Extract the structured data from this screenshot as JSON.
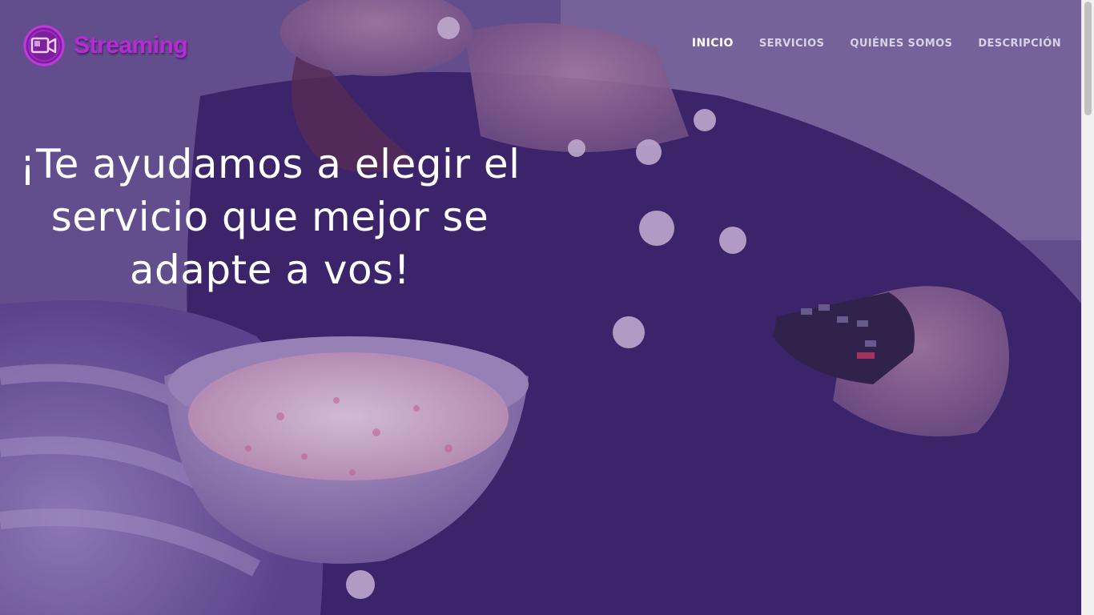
{
  "brand": {
    "name": "Streaming",
    "logo_icon": "video-camera-icon",
    "color": "#b52bd6"
  },
  "nav": {
    "items": [
      {
        "label": "INICIO",
        "active": true
      },
      {
        "label": "SERVICIOS",
        "active": false
      },
      {
        "label": "QUIÉNES SOMOS",
        "active": false
      },
      {
        "label": "DESCRIPCIÓN",
        "active": false
      }
    ]
  },
  "hero": {
    "headline": "¡Te ayudamos a elegir el servicio que mejor se adapte a vos!",
    "background_description_icon": "popcorn-remote-photo"
  },
  "colors": {
    "overlay": "#5a3a8a",
    "nav_text": "#d8d2e6",
    "headline_text": "#ffffff"
  }
}
